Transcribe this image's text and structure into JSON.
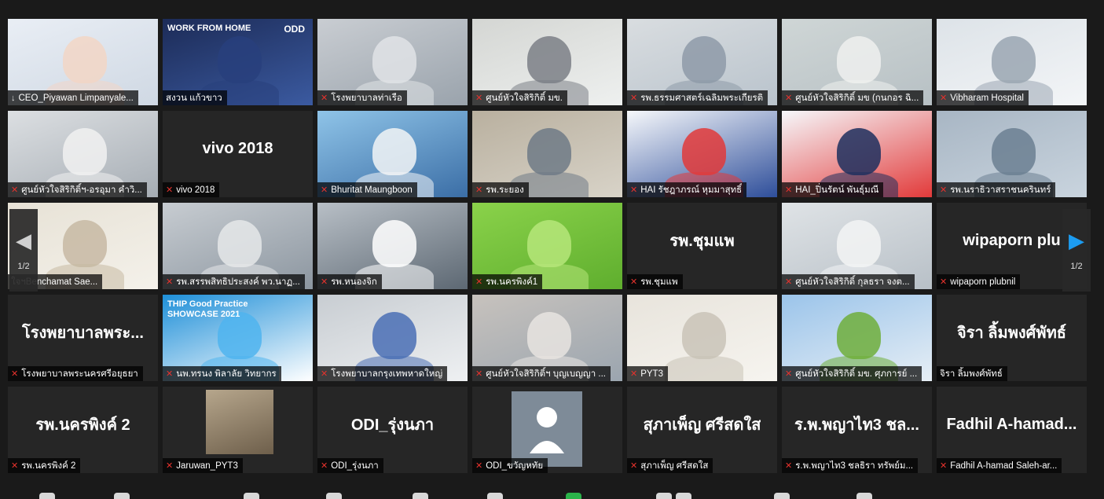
{
  "pagination": {
    "current": "1/2"
  },
  "tiles": [
    {
      "label": "CEO_Piyawan Limpanyale...",
      "icon": "pin-icon"
    },
    {
      "label": "สงวน แก้วขาว",
      "icon": "none",
      "active": true,
      "banner": "WORK FROM HOME",
      "banner_brand": "ODD"
    },
    {
      "label": "โรงพยาบาลท่าเรือ",
      "icon": "mic-muted-icon"
    },
    {
      "label": "ศูนย์หัวใจสิริกิติ์ มข.",
      "icon": "mic-muted-icon"
    },
    {
      "label": "รพ.ธรรมศาสตร์เฉลิมพระเกียรติ",
      "icon": "mic-muted-icon"
    },
    {
      "label": "ศูนย์หัวใจสิริกิติ์ มข (กนกอร ฉิ...",
      "icon": "mic-muted-icon"
    },
    {
      "label": "Vibharam Hospital",
      "icon": "mic-muted-icon"
    },
    {
      "label": "ศูนย์หัวใจสิริกิติ์ฯ-อรอุมา คำวิ...",
      "icon": "mic-muted-icon"
    },
    {
      "label": "vivo 2018",
      "icon": "mic-muted-icon",
      "big_name": "vivo 2018"
    },
    {
      "label": "Bhuritat Maungboon",
      "icon": "mic-muted-icon"
    },
    {
      "label": "รพ.ระยอง",
      "icon": "mic-muted-icon"
    },
    {
      "label": "HAI รัชฎาภรณ์ หุมมาสุทธิ์",
      "icon": "mic-muted-icon"
    },
    {
      "label": "HAI_ปิ่นรัตน์ พันธุ์มณี",
      "icon": "mic-muted-icon"
    },
    {
      "label": "รพ.นราธิวาสราชนครินทร์",
      "icon": "mic-muted-icon"
    },
    {
      "label": "ใจฯBenchamat Sae...",
      "icon": "none"
    },
    {
      "label": "รพ.สรรพสิทธิประสงค์ พว.นาฏ...",
      "icon": "mic-muted-icon"
    },
    {
      "label": "รพ.หนองจิก",
      "icon": "mic-muted-icon"
    },
    {
      "label": "รพ.นครพิงค์1",
      "icon": "mic-muted-icon"
    },
    {
      "label": "รพ.ชุมแพ",
      "icon": "mic-muted-icon",
      "big_name": "รพ.ชุมแพ"
    },
    {
      "label": "ศูนย์หัวใจสิริกิติ์ กุลธรา จงต...",
      "icon": "mic-muted-icon"
    },
    {
      "label": "wipaporn plubnil",
      "icon": "mic-muted-icon",
      "big_name": "wipaporn plu"
    },
    {
      "label": "โรงพยาบาลพระนครศรีอยุธยา",
      "icon": "mic-muted-icon",
      "big_name": "โรงพยาบาลพระ..."
    },
    {
      "label": "นพ.ทรนง พิลาลัย วิทยากร",
      "icon": "mic-muted-icon",
      "banner": "THIP Good Practice SHOWCASE 2021"
    },
    {
      "label": "โรงพยาบาลกรุงเทพหาดใหญ่",
      "icon": "mic-muted-icon"
    },
    {
      "label": "ศูนย์หัวใจสิริกิติ์ฯ บุญเบญญา ...",
      "icon": "mic-muted-icon"
    },
    {
      "label": "PYT3",
      "icon": "mic-muted-icon"
    },
    {
      "label": "ศูนย์หัวใจสิริกิติ์ มข. ศุภการย์ ...",
      "icon": "mic-muted-icon"
    },
    {
      "label": "จิรา ลิ้มพงศ์พัทธ์",
      "icon": "none",
      "big_name": "จิรา ลิ้มพงศ์พัทธ์"
    },
    {
      "label": "รพ.นครพิงค์ 2",
      "icon": "mic-muted-icon",
      "big_name": "รพ.นครพิงค์ 2"
    },
    {
      "label": "Jaruwan_PYT3",
      "icon": "mic-muted-icon"
    },
    {
      "label": "ODI_รุ่งนภา",
      "icon": "mic-muted-icon",
      "big_name": "ODI_รุ่งนภา"
    },
    {
      "label": "ODI_ขวัญหทัย",
      "icon": "mic-muted-icon"
    },
    {
      "label": "สุภาเพ็ญ ศรีสดใส",
      "icon": "mic-muted-icon",
      "big_name": "สุภาเพ็ญ ศรีสดใส"
    },
    {
      "label": "ร.พ.พญาไท3 ชลธิรา ทรัพย์ม...",
      "icon": "mic-muted-icon",
      "big_name": "ร.พ.พญาไท3 ชล..."
    },
    {
      "label": "Fadhil A-hamad Saleh-ar...",
      "icon": "mic-muted-icon",
      "big_name": "Fadhil  A-hamad..."
    }
  ]
}
